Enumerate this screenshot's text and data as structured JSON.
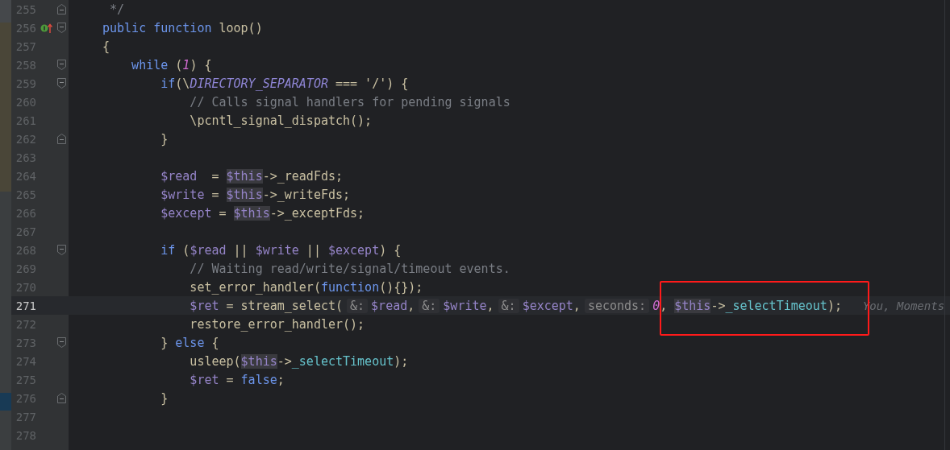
{
  "editor": {
    "lines": [
      {
        "number": "255",
        "current": false,
        "fold_end": true,
        "tokens": [
          {
            "kind": "comment",
            "text": " */"
          }
        ]
      },
      {
        "number": "256",
        "current": false,
        "fold_start": true,
        "implemented_marker": true,
        "tokens": [
          {
            "kind": "keyword",
            "text": "public function"
          },
          {
            "kind": "plain",
            "text": " loop()"
          }
        ]
      },
      {
        "number": "257",
        "current": false,
        "tokens": [
          {
            "kind": "plain",
            "text": "{"
          }
        ]
      },
      {
        "number": "258",
        "current": false,
        "fold_start": true,
        "tokens": [
          {
            "kind": "keyword",
            "text": "    while"
          },
          {
            "kind": "plain",
            "text": " ("
          },
          {
            "kind": "number",
            "text": "1"
          },
          {
            "kind": "plain",
            "text": ") {"
          }
        ]
      },
      {
        "number": "259",
        "current": false,
        "fold_start": true,
        "tokens": [
          {
            "kind": "keyword",
            "text": "        if"
          },
          {
            "kind": "plain",
            "text": "(\\"
          },
          {
            "kind": "constant",
            "text": "DIRECTORY_SEPARATOR"
          },
          {
            "kind": "plain",
            "text": " === '/') {"
          }
        ]
      },
      {
        "number": "260",
        "current": false,
        "tokens": [
          {
            "kind": "comment",
            "text": "            // Calls signal handlers for pending signals"
          }
        ]
      },
      {
        "number": "261",
        "current": false,
        "tokens": [
          {
            "kind": "plain",
            "text": "            \\pcntl_signal_dispatch();"
          }
        ]
      },
      {
        "number": "262",
        "current": false,
        "fold_end": true,
        "tokens": [
          {
            "kind": "plain",
            "text": "        }"
          }
        ]
      },
      {
        "number": "263",
        "current": false
      },
      {
        "number": "264",
        "current": false,
        "tokens": [
          {
            "kind": "variable",
            "text": "        $read"
          },
          {
            "kind": "plain",
            "text": "  = "
          },
          {
            "kind": "this",
            "text": "$this"
          },
          {
            "kind": "plain",
            "text": "->_readFds;"
          }
        ]
      },
      {
        "number": "265",
        "current": false,
        "tokens": [
          {
            "kind": "variable",
            "text": "        $write"
          },
          {
            "kind": "plain",
            "text": " = "
          },
          {
            "kind": "this",
            "text": "$this"
          },
          {
            "kind": "plain",
            "text": "->_writeFds;"
          }
        ]
      },
      {
        "number": "266",
        "current": false,
        "tokens": [
          {
            "kind": "variable",
            "text": "        $except"
          },
          {
            "kind": "plain",
            "text": " = "
          },
          {
            "kind": "this",
            "text": "$this"
          },
          {
            "kind": "plain",
            "text": "->_exceptFds;"
          }
        ]
      },
      {
        "number": "267",
        "current": false
      },
      {
        "number": "268",
        "current": false,
        "fold_start": true,
        "tokens": [
          {
            "kind": "keyword",
            "text": "        if"
          },
          {
            "kind": "plain",
            "text": " ("
          },
          {
            "kind": "variable",
            "text": "$read"
          },
          {
            "kind": "plain",
            "text": " || "
          },
          {
            "kind": "variable",
            "text": "$write"
          },
          {
            "kind": "plain",
            "text": " || "
          },
          {
            "kind": "variable",
            "text": "$except"
          },
          {
            "kind": "plain",
            "text": ") {"
          }
        ]
      },
      {
        "number": "269",
        "current": false,
        "tokens": [
          {
            "kind": "comment",
            "text": "            // Waiting read/write/signal/timeout events."
          }
        ]
      },
      {
        "number": "270",
        "current": false,
        "tokens": [
          {
            "kind": "plain",
            "text": "            set_error_handler("
          },
          {
            "kind": "keyword",
            "text": "function"
          },
          {
            "kind": "plain",
            "text": "(){});"
          }
        ]
      },
      {
        "number": "271",
        "current": true,
        "tokens": [
          {
            "kind": "variable",
            "text": "            $ret"
          },
          {
            "kind": "plain",
            "text": " = stream_select("
          },
          {
            "kind": "hint",
            "text": "&:"
          },
          {
            "kind": "variable",
            "text": "$read"
          },
          {
            "kind": "plain",
            "text": ","
          },
          {
            "kind": "hint",
            "text": "&:"
          },
          {
            "kind": "variable",
            "text": "$write"
          },
          {
            "kind": "plain",
            "text": ","
          },
          {
            "kind": "hint",
            "text": "&:"
          },
          {
            "kind": "variable",
            "text": "$except"
          },
          {
            "kind": "plain",
            "text": ","
          },
          {
            "kind": "hint",
            "text": "seconds:"
          },
          {
            "kind": "number",
            "text": "0"
          },
          {
            "kind": "plain",
            "text": ", "
          },
          {
            "kind": "this",
            "text": "$this"
          },
          {
            "kind": "plain",
            "text": "->"
          },
          {
            "kind": "field",
            "text": "_selectTimeout"
          },
          {
            "kind": "plain",
            "text": ");"
          },
          {
            "kind": "blame",
            "text": "You, Moments"
          }
        ]
      },
      {
        "number": "272",
        "current": false,
        "tokens": [
          {
            "kind": "plain",
            "text": "            restore_error_handler();"
          }
        ]
      },
      {
        "number": "273",
        "current": false,
        "fold_start": true,
        "tokens": [
          {
            "kind": "plain",
            "text": "        }"
          },
          {
            "kind": "keyword",
            "text": " else"
          },
          {
            "kind": "plain",
            "text": " {"
          }
        ]
      },
      {
        "number": "274",
        "current": false,
        "tokens": [
          {
            "kind": "plain",
            "text": "            usleep("
          },
          {
            "kind": "this",
            "text": "$this"
          },
          {
            "kind": "plain",
            "text": "->"
          },
          {
            "kind": "field",
            "text": "_selectTimeout"
          },
          {
            "kind": "plain",
            "text": ");"
          }
        ]
      },
      {
        "number": "275",
        "current": false,
        "tokens": [
          {
            "kind": "variable",
            "text": "            $ret"
          },
          {
            "kind": "plain",
            "text": " = "
          },
          {
            "kind": "keyword",
            "text": "false"
          },
          {
            "kind": "plain",
            "text": ";"
          }
        ]
      },
      {
        "number": "276",
        "current": false,
        "fold_end": true,
        "tokens": [
          {
            "kind": "plain",
            "text": "        }"
          }
        ]
      },
      {
        "number": "277",
        "current": false
      },
      {
        "number": "278",
        "current": false
      }
    ]
  }
}
